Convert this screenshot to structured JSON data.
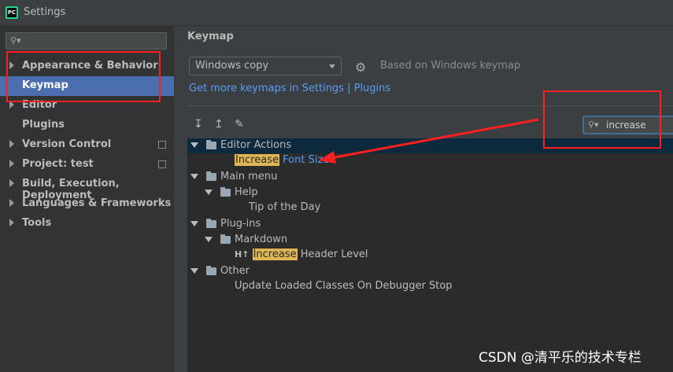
{
  "window": {
    "title": "Settings",
    "app_icon": "PC"
  },
  "sidebar": {
    "search_placeholder": "",
    "items": [
      {
        "label": "Appearance & Behavior",
        "expandable": true,
        "selected": false
      },
      {
        "label": "Keymap",
        "expandable": false,
        "selected": true
      },
      {
        "label": "Editor",
        "expandable": true,
        "selected": false
      },
      {
        "label": "Plugins",
        "expandable": false,
        "selected": false
      },
      {
        "label": "Version Control",
        "expandable": true,
        "selected": false
      },
      {
        "label": "Project: test",
        "expandable": true,
        "selected": false
      },
      {
        "label": "Build, Execution, Deployment",
        "expandable": true,
        "selected": false
      },
      {
        "label": "Languages & Frameworks",
        "expandable": true,
        "selected": false
      },
      {
        "label": "Tools",
        "expandable": true,
        "selected": false
      }
    ]
  },
  "main": {
    "title": "Keymap",
    "keymap_select": "Windows copy",
    "based_on": "Based on Windows keymap",
    "more_link": "Get more keymaps in Settings | Plugins",
    "filter_value": "increase"
  },
  "tree": {
    "editor_actions": "Editor Actions",
    "increase_1": "Increase",
    "font_size": "Font Size",
    "main_menu": "Main menu",
    "help": "Help",
    "tip_of_day": "Tip of the Day",
    "plugins": "Plug-ins",
    "markdown": "Markdown",
    "ht": "H↑",
    "increase_2": "Increase",
    "header_level": "Header Level",
    "other": "Other",
    "update_loaded": "Update Loaded Classes On Debugger Stop"
  },
  "watermark": "CSDN @清平乐的技术专栏",
  "colors": {
    "selection": "#4b6eaf",
    "highlight": "#e0b654",
    "link": "#589df6",
    "annotation": "#ff1f1f"
  }
}
